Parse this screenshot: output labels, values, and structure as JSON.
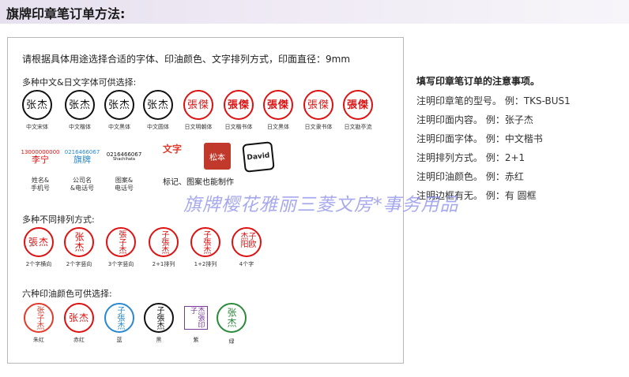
{
  "header": {
    "title": "旗牌印章笔订单方法:"
  },
  "panel": {
    "instruction": "请根据具体用途选择合适的字体、印油颜色、文字排列方式，印面直径：9mm",
    "fonts": {
      "title": "多种中文&日文字体可供选择:",
      "samples": [
        {
          "text": "张杰",
          "caption": "中文宋体",
          "color": "black"
        },
        {
          "text": "张杰",
          "caption": "中文楷体",
          "color": "black"
        },
        {
          "text": "张杰",
          "caption": "中文黑体",
          "color": "black"
        },
        {
          "text": "张杰",
          "caption": "中文圆体",
          "color": "black"
        },
        {
          "text": "張傑",
          "caption": "日文明朝体",
          "color": "red"
        },
        {
          "text": "張傑",
          "caption": "日文楷书体",
          "color": "red"
        },
        {
          "text": "張傑",
          "caption": "日文黑体",
          "color": "red"
        },
        {
          "text": "張傑",
          "caption": "日文隶书体",
          "color": "red"
        },
        {
          "text": "張傑",
          "caption": "日文勘亭流",
          "color": "red"
        }
      ],
      "special": [
        {
          "top": "13000000000",
          "main": "李宁",
          "caption": "姓名&\n手机号"
        },
        {
          "top": "0216466067",
          "main": "旗牌",
          "caption": "公司名\n&电话号"
        },
        {
          "top": "0216466067",
          "main": "Shachihata",
          "caption": "图案&\n电话号"
        }
      ],
      "marks": [
        "文字",
        "松本",
        "David"
      ],
      "marks_caption": "标记、图案也能制作"
    },
    "layouts": {
      "title": "多种不同排列方式:",
      "samples": [
        {
          "text": "張杰",
          "caption": "2个字横向"
        },
        {
          "text": "张杰",
          "caption": "2个字竖向"
        },
        {
          "text": "張子杰",
          "caption": "3个字竖向"
        },
        {
          "text": "子張杰",
          "caption": "2+1排列"
        },
        {
          "text": "子張杰",
          "caption": "1+2排列"
        },
        {
          "text": "子欧杰阳",
          "caption": "4个字"
        }
      ]
    },
    "colors": {
      "title": "六种印油颜色可供选择:",
      "samples": [
        {
          "text": "张子杰",
          "caption": "朱红",
          "color": "#e23a2a"
        },
        {
          "text": "张杰",
          "caption": "赤红",
          "color": "#d11111"
        },
        {
          "text": "子張杰",
          "caption": "蓝",
          "color": "#2a88d0"
        },
        {
          "text": "子張杰",
          "caption": "黑",
          "color": "#111111"
        },
        {
          "text": "杰張印子",
          "caption": "紫",
          "color": "#7a3a9a"
        },
        {
          "text": "张杰",
          "caption": "绿",
          "color": "#2a8a3a"
        }
      ]
    }
  },
  "notes": {
    "title": "填写印章笔订单的注意事项。",
    "lines": [
      "注明印章笔的型号。 例：TKS-BUS1",
      "注明印面内容。 例：张子杰",
      "注明印面字体。 例：中文楷书",
      "注明排列方式。 例：2+1",
      "注明印油颜色。 例：赤红",
      "注明边框有无。 例：有  圆框"
    ]
  },
  "watermark": "旗牌樱花雅丽三菱文房*事务用品"
}
